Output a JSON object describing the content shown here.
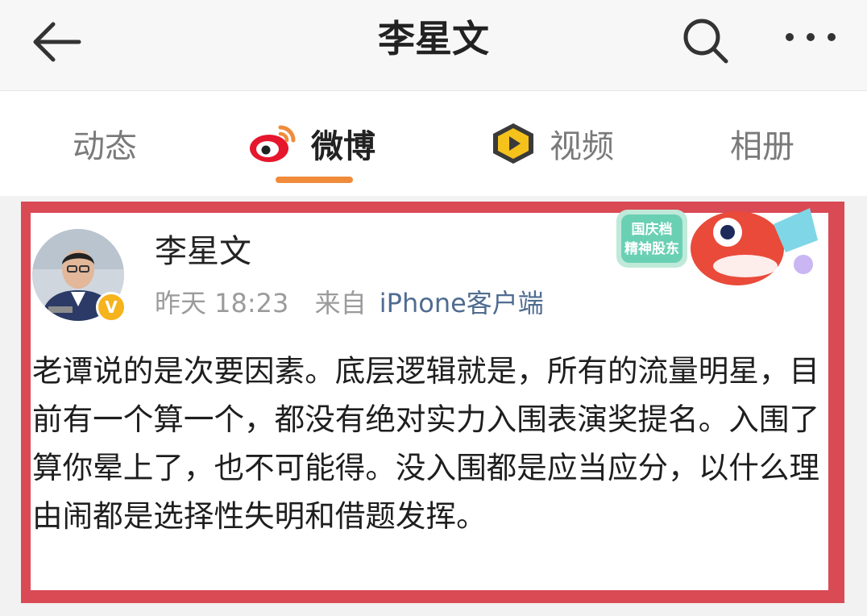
{
  "header": {
    "title": "李星文",
    "back_icon": "arrow-left-icon",
    "search_icon": "search-icon",
    "more_icon": "more-horizontal-icon"
  },
  "tabs": [
    {
      "label": "动态",
      "icon": null,
      "active": false
    },
    {
      "label": "微博",
      "icon": "weibo-logo-icon",
      "active": true
    },
    {
      "label": "视频",
      "icon": "video-badge-icon",
      "active": false
    },
    {
      "label": "相册",
      "icon": null,
      "active": false
    }
  ],
  "post": {
    "author": "李星文",
    "verified": true,
    "verified_badge": "V",
    "time": "昨天 18:23",
    "source_prefix": "来自",
    "source": "iPhone客户端",
    "sticker_text": [
      "国庆档",
      "精神股东"
    ],
    "text": "老谭说的是次要因素。底层逻辑就是，所有的流量明星，目前有一个算一个，都没有绝对实力入围表演奖提名。入围了算你晕上了，也不可能得。没入围都是应当应分，以什么理由闹都是选择性失明和借题发挥。"
  },
  "colors": {
    "accent": "#f08b3c",
    "highlight_frame": "#d94a55",
    "link": "#506c91",
    "verified": "#f5b31c"
  }
}
